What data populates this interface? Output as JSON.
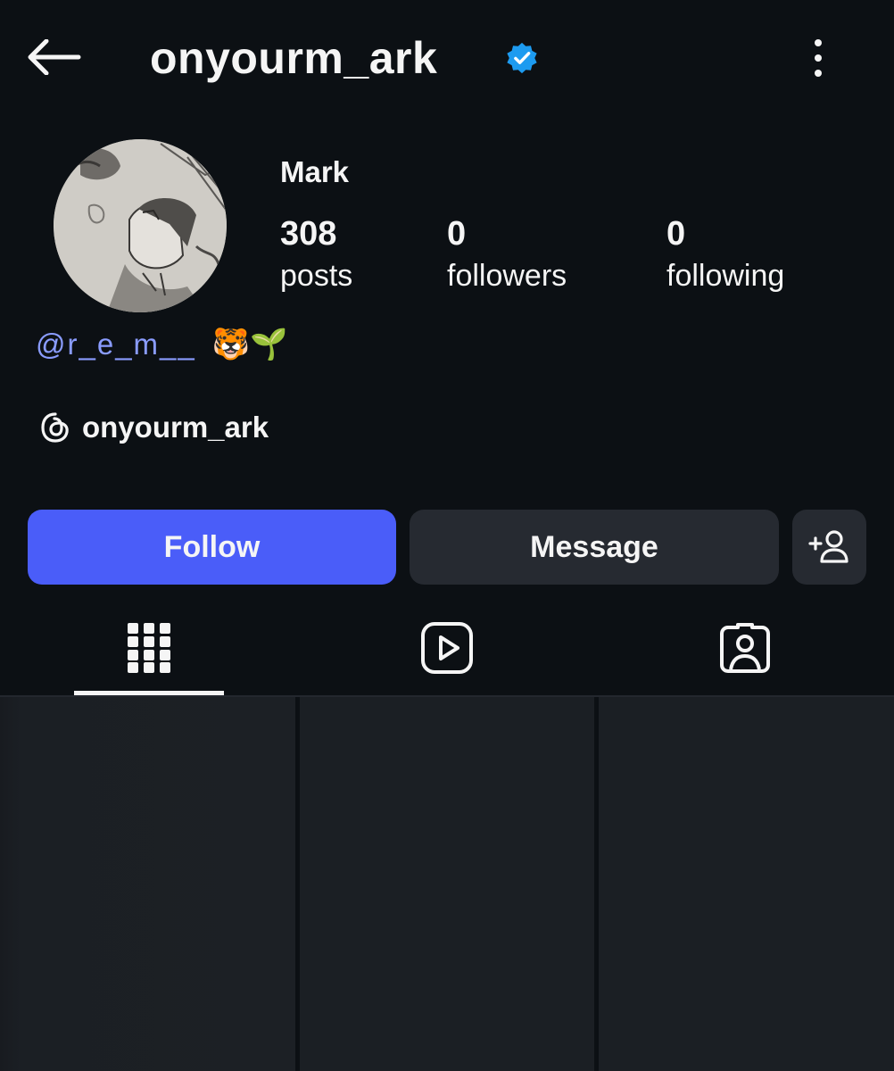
{
  "header": {
    "username": "onyourm_ark",
    "verified_color": "#1d9bf0"
  },
  "profile": {
    "display_name": "Mark",
    "stats": {
      "posts_count": "308",
      "posts_label": "posts",
      "followers_count": "0",
      "followers_label": "followers",
      "following_count": "0",
      "following_label": "following"
    },
    "bio": {
      "mention": "@r_e_m__",
      "emojis": "🐯🌱"
    },
    "threads_handle": "onyourm_ark"
  },
  "actions": {
    "follow_label": "Follow",
    "message_label": "Message",
    "follow_color": "#4a5df9"
  },
  "tabs": [
    {
      "icon": "grid-icon",
      "active": true
    },
    {
      "icon": "reels-icon",
      "active": false
    },
    {
      "icon": "tagged-icon",
      "active": false
    }
  ]
}
